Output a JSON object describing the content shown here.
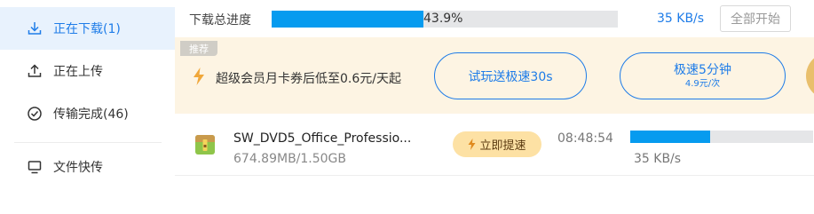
{
  "sidebar": {
    "items": [
      {
        "label": "正在下载(1)",
        "icon": "download-icon",
        "active": true
      },
      {
        "label": "正在上传",
        "icon": "upload-icon",
        "active": false
      },
      {
        "label": "传输完成(46)",
        "icon": "check-circle-icon",
        "active": false
      },
      {
        "label": "文件快传",
        "icon": "monitor-icon",
        "active": false
      }
    ]
  },
  "overall": {
    "label": "下载总进度",
    "percent_text": "43.9%",
    "percent": 43.9,
    "speed": "35 KB/s",
    "start_all_label": "全部开始"
  },
  "promo": {
    "tag": "推荐",
    "text": "超级会员月卡券后低至0.6元/天起",
    "trial_label": "试玩送极速30s",
    "speed_label": "极速5分钟",
    "speed_price": "4.9元/次"
  },
  "download": {
    "name": "SW_DVD5_Office_Professio...",
    "size": "674.89MB/1.50GB",
    "boost_label": "立即提速",
    "time_left": "08:48:54",
    "progress": 0.439,
    "speed": "35 KB/s"
  },
  "colors": {
    "accent": "#1e7ce8",
    "progress": "#069bef",
    "promo_bg": "#fdf4e3",
    "boost_bg": "#fde1a4",
    "active_bg": "#e8f2fd"
  }
}
